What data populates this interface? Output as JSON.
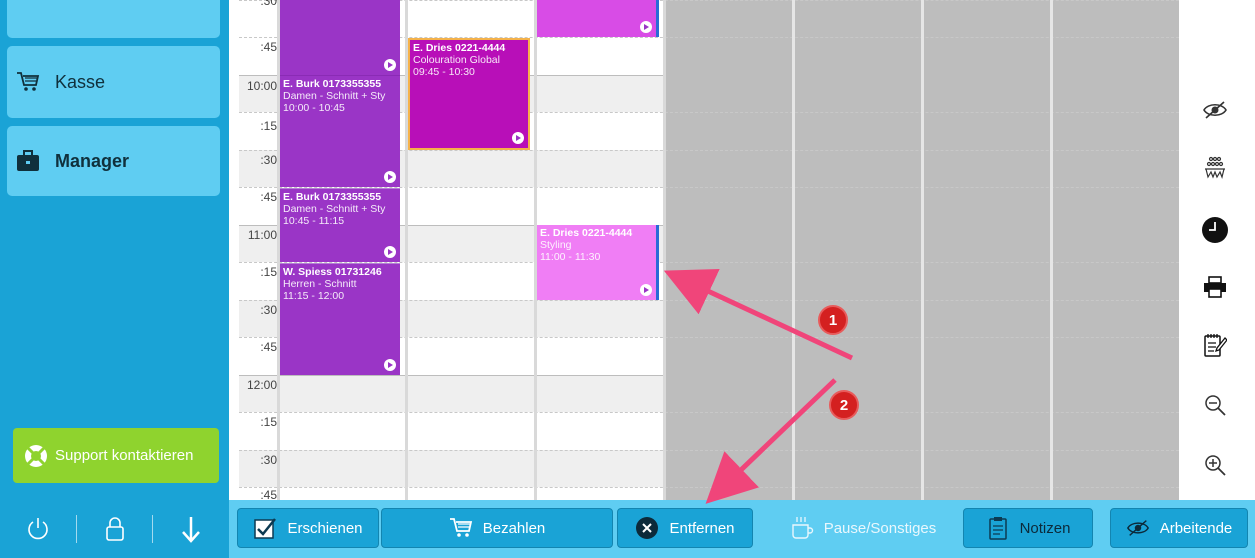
{
  "sidebar": {
    "items": [
      {
        "label": "Kasse",
        "icon": "cart-icon"
      },
      {
        "label": "Manager",
        "icon": "briefcase-icon"
      }
    ],
    "support_label": "Support kontaktieren",
    "bottom_icons": [
      "power-icon",
      "lock-icon",
      "arrow-down-icon"
    ]
  },
  "calendar": {
    "time_labels": [
      ":30",
      ":45",
      "10:00",
      ":15",
      ":30",
      ":45",
      "11:00",
      ":15",
      ":30",
      ":45",
      "12:00",
      ":15",
      ":30",
      ":45"
    ],
    "appointments": [
      {
        "name": "E. Burk 0173355355",
        "service": "Damen - Schnitt + Sty",
        "time": "10:00 - 10:45",
        "color": "#9a35c6"
      },
      {
        "name": "E. Burk 0173355355",
        "service": "Damen - Schnitt + Sty",
        "time": "10:45 - 11:15",
        "color": "#9a35c6"
      },
      {
        "name": "W. Spiess 01731246",
        "service": "Herren - Schnitt",
        "time": "11:15 - 12:00",
        "color": "#9a35c6"
      },
      {
        "name": "E. Dries 0221-4444",
        "service": "Colouration Global",
        "time": "09:45 - 10:30",
        "color": "#b80fb8"
      },
      {
        "name": "E. Dries 0221-4444",
        "service": "Styling",
        "time": "11:00 - 11:30",
        "color": "#f07ef5"
      }
    ]
  },
  "right_toolbar": [
    "eye-slash-icon",
    "group-icon",
    "clock-icon",
    "printer-icon",
    "notepad-icon",
    "zoom-out-icon",
    "zoom-in-icon"
  ],
  "action_bar": {
    "erschienen": "Erschienen",
    "bezahlen": "Bezahlen",
    "entfernen": "Entfernen",
    "pause": "Pause/Sonstiges",
    "notizen": "Notizen",
    "arbeitende": "Arbeitende"
  },
  "annotations": {
    "badge1": "1",
    "badge2": "2"
  },
  "colors": {
    "sidebar": "#1aa3d6",
    "sidebar_button": "#5fcdf2",
    "support": "#8fd32e",
    "annotation": "#f0457a",
    "badge": "#d42020"
  }
}
